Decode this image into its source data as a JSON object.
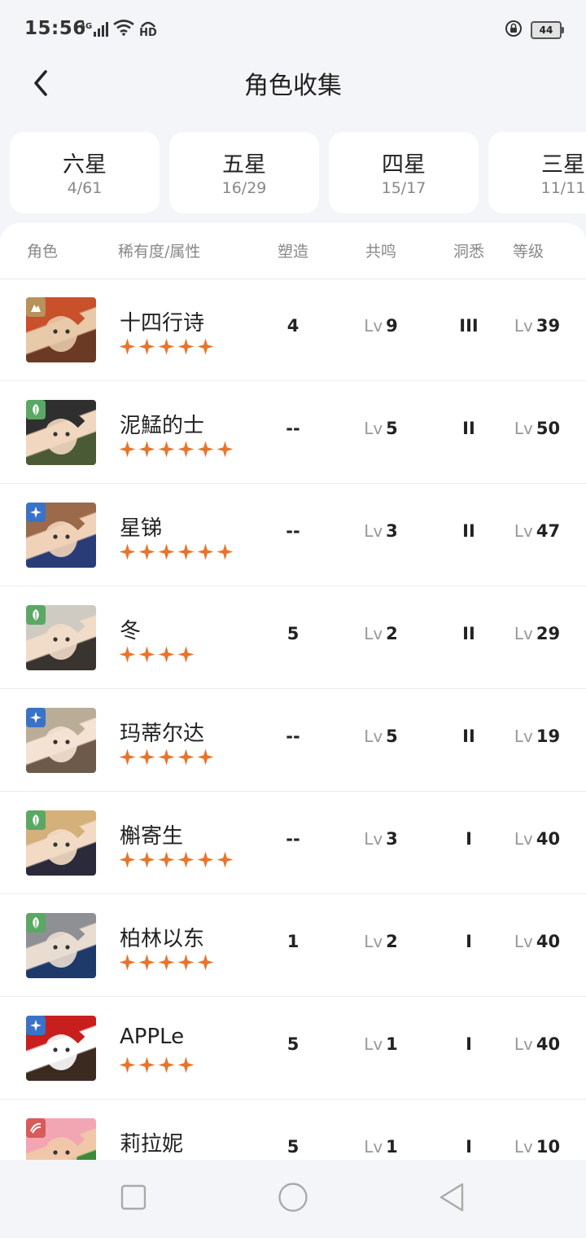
{
  "status_bar": {
    "time": "15:56",
    "network": "4G",
    "hd": "HD",
    "battery": "44"
  },
  "header": {
    "title": "角色收集",
    "back_icon": "chevron-left-icon"
  },
  "tabs": [
    {
      "name": "六星",
      "count": "4/61"
    },
    {
      "name": "五星",
      "count": "16/29"
    },
    {
      "name": "四星",
      "count": "15/17"
    },
    {
      "name": "三星",
      "count": "11/11"
    }
  ],
  "columns": {
    "role": "角色",
    "rarity": "稀有度/属性",
    "shaping": "塑造",
    "resonance": "共鸣",
    "insight": "洞悉",
    "level": "等级"
  },
  "lv_prefix": "Lv",
  "characters": [
    {
      "name": "十四行诗",
      "stars": 5,
      "attribute": "mineral",
      "shaping": "4",
      "resonance": "9",
      "insight": "III",
      "level": "39",
      "palette": [
        "#c8502a",
        "#e8c9a8",
        "#6b3a24"
      ]
    },
    {
      "name": "泥鯭的士",
      "stars": 6,
      "attribute": "plant",
      "shaping": "--",
      "resonance": "5",
      "insight": "II",
      "level": "50",
      "palette": [
        "#2f2f2f",
        "#f1d7c0",
        "#4a5a34"
      ]
    },
    {
      "name": "星锑",
      "stars": 6,
      "attribute": "star",
      "shaping": "--",
      "resonance": "3",
      "insight": "II",
      "level": "47",
      "palette": [
        "#9a6a4a",
        "#f0d2b8",
        "#2a3c78"
      ]
    },
    {
      "name": "冬",
      "stars": 4,
      "attribute": "plant",
      "shaping": "5",
      "resonance": "2",
      "insight": "II",
      "level": "29",
      "palette": [
        "#cfcac2",
        "#f0dcc8",
        "#3a3430"
      ]
    },
    {
      "name": "玛蒂尔达",
      "stars": 5,
      "attribute": "star",
      "shaping": "--",
      "resonance": "5",
      "insight": "II",
      "level": "19",
      "palette": [
        "#b9ad98",
        "#f4e2d4",
        "#6d5a4a"
      ]
    },
    {
      "name": "槲寄生",
      "stars": 6,
      "attribute": "plant",
      "shaping": "--",
      "resonance": "3",
      "insight": "I",
      "level": "40",
      "palette": [
        "#d4b07a",
        "#f2dac4",
        "#2b2a3a"
      ]
    },
    {
      "name": "柏林以东",
      "stars": 5,
      "attribute": "plant",
      "shaping": "1",
      "resonance": "2",
      "insight": "I",
      "level": "40",
      "palette": [
        "#8e9094",
        "#e9ddd2",
        "#1e3a6a"
      ]
    },
    {
      "name": "APPLe",
      "stars": 4,
      "attribute": "star",
      "shaping": "5",
      "resonance": "1",
      "insight": "I",
      "level": "40",
      "palette": [
        "#c81e1e",
        "#ffffff",
        "#3a2a20"
      ]
    },
    {
      "name": "莉拉妮",
      "stars": 0,
      "attribute": "beast",
      "shaping": "5",
      "resonance": "1",
      "insight": "I",
      "level": "10",
      "palette": [
        "#f2a6b4",
        "#f0c8a8",
        "#3a8a3a"
      ]
    }
  ],
  "colors": {
    "star": "#e8742c",
    "attr_plant": "#5aa864",
    "attr_star": "#3a72c8",
    "attr_mineral": "#b8925a",
    "attr_beast": "#d85a5a",
    "background": "#f4f5f8"
  },
  "nav_bar": [
    "square-icon",
    "circle-icon",
    "triangle-back-icon"
  ]
}
